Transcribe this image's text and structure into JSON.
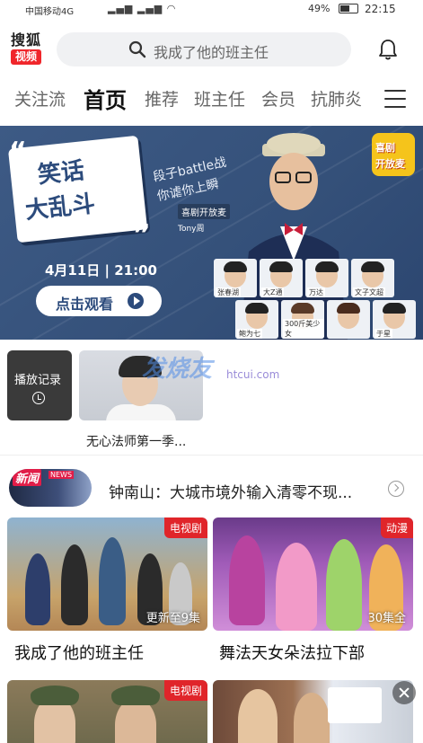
{
  "status_bar": {
    "carrier": "中国移动4G",
    "battery": "49%",
    "time": "22:15"
  },
  "header": {
    "logo_line1": "搜狐",
    "logo_line2": "视频",
    "search_placeholder": "我成了他的班主任"
  },
  "tabs": [
    {
      "label": "关注流"
    },
    {
      "label": "首页"
    },
    {
      "label": "推荐"
    },
    {
      "label": "班主任"
    },
    {
      "label": "会员"
    },
    {
      "label": "抗肺炎"
    }
  ],
  "banner": {
    "title_line1": "笑话",
    "title_line2": "大乱斗",
    "slogan_line1": "段子battle战",
    "slogan_line2": "你谑你上瞬",
    "show_tag": "喜剧开放麦",
    "host": "Tony周",
    "date": "4月11日",
    "time": "21:00",
    "cta": "点击观看",
    "brand_line1": "喜剧",
    "brand_line2": "开放麦",
    "cast": [
      "张春湖",
      "大Z通",
      "万达",
      "文子文超",
      "鲍为七",
      "300斤美少女",
      "",
      "于星"
    ]
  },
  "history": {
    "label": "播放记录"
  },
  "recent": {
    "title": "无心法师第一季..."
  },
  "watermark": {
    "text": "发烧友",
    "url": "htcui.com"
  },
  "news": {
    "badge": "新闻",
    "badge_sub": "NEWS",
    "headline": "钟南山：大城市境外输入清零不现..."
  },
  "cards": [
    {
      "badge": "电视剧",
      "note": "更新至9集",
      "title": "我成了他的班主任"
    },
    {
      "badge": "动漫",
      "note": "30集全",
      "title": "舞法天女朵法拉下部"
    },
    {
      "badge": "电视剧",
      "note": "",
      "title": ""
    },
    {
      "badge": "",
      "note": "",
      "title": ""
    }
  ],
  "colors": {
    "brand_red": "#f0262b",
    "badge_red": "#e0252a",
    "banner_blue": "#3d5a85"
  }
}
